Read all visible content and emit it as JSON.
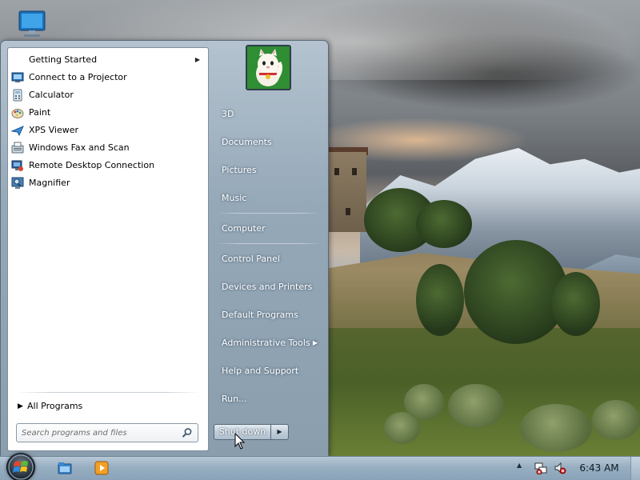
{
  "start_menu": {
    "programs": [
      {
        "label": "Getting Started",
        "icon": "getting-started-icon",
        "has_submenu": true
      },
      {
        "label": "Connect to a Projector",
        "icon": "projector-icon",
        "has_submenu": false
      },
      {
        "label": "Calculator",
        "icon": "calculator-icon",
        "has_submenu": false
      },
      {
        "label": "Paint",
        "icon": "paint-icon",
        "has_submenu": false
      },
      {
        "label": "XPS Viewer",
        "icon": "xps-viewer-icon",
        "has_submenu": false
      },
      {
        "label": "Windows Fax and Scan",
        "icon": "fax-scan-icon",
        "has_submenu": false
      },
      {
        "label": "Remote Desktop Connection",
        "icon": "remote-desktop-icon",
        "has_submenu": false
      },
      {
        "label": "Magnifier",
        "icon": "magnifier-icon",
        "has_submenu": false
      }
    ],
    "all_programs_label": "All Programs",
    "search_placeholder": "Search programs and files",
    "right_items": [
      {
        "label": "3D",
        "has_submenu": false
      },
      {
        "label": "Documents",
        "has_submenu": false
      },
      {
        "label": "Pictures",
        "has_submenu": false
      },
      {
        "label": "Music",
        "has_submenu": false
      },
      {
        "label": "Computer",
        "has_submenu": false
      },
      {
        "label": "Control Panel",
        "has_submenu": false
      },
      {
        "label": "Devices and Printers",
        "has_submenu": false
      },
      {
        "label": "Default Programs",
        "has_submenu": false
      },
      {
        "label": "Administrative Tools",
        "has_submenu": true
      },
      {
        "label": "Help and Support",
        "has_submenu": false
      },
      {
        "label": "Run...",
        "has_submenu": false
      }
    ],
    "shutdown_label": "Shut down",
    "submenu_arrow": "▶"
  },
  "taskbar": {
    "pinned": [
      {
        "icon": "explorer-icon"
      },
      {
        "icon": "media-player-icon"
      }
    ],
    "tray_expand": "▲",
    "tray_icons": [
      "network-icon",
      "volume-muted-icon"
    ],
    "clock": "6:43 AM"
  },
  "colors": {
    "taskbar": "#97aec1",
    "start_menu_frame": "#95a8b8",
    "right_pane_text": "#ffffff"
  }
}
